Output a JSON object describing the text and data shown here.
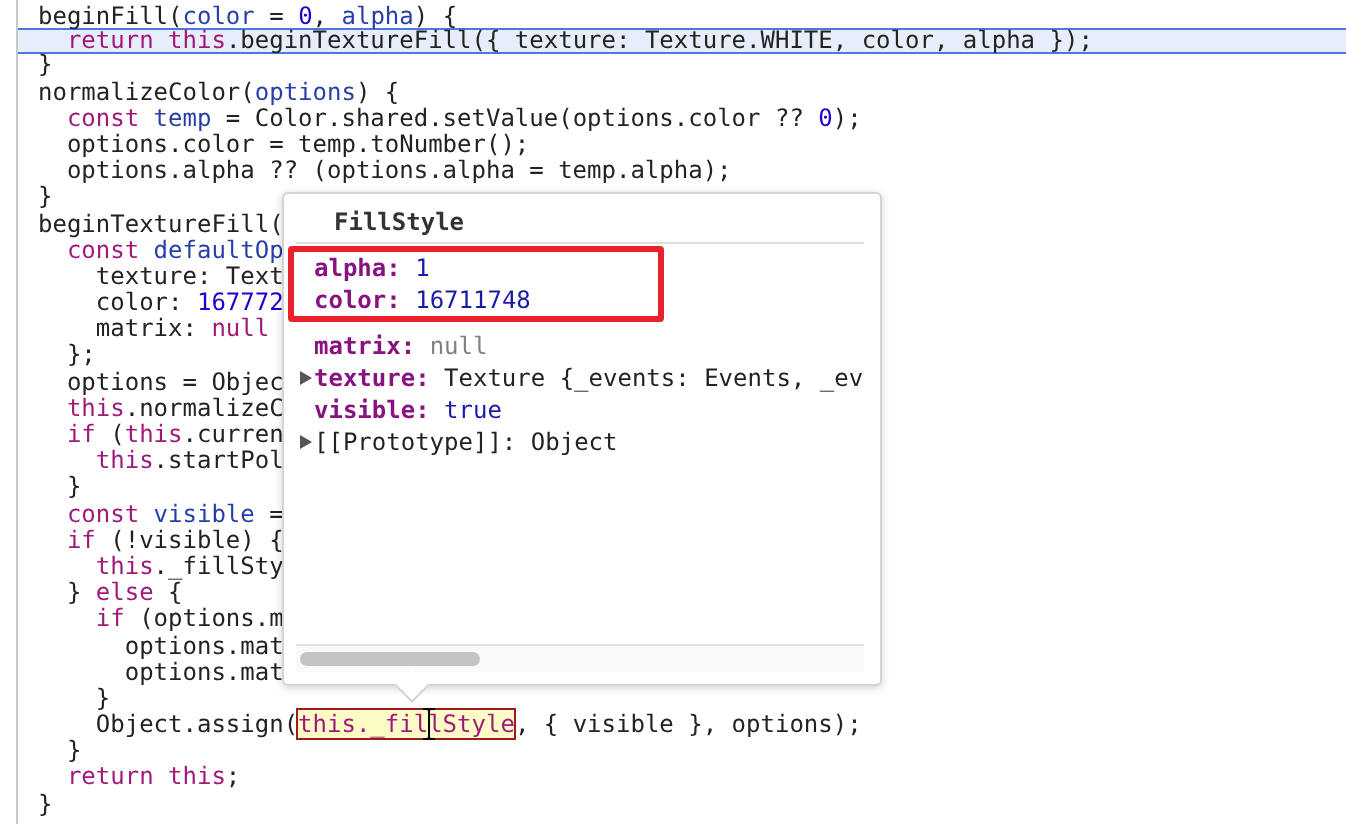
{
  "code_lines": [
    {
      "current": false,
      "tokens": [
        {
          "kind": "plain",
          "text": "beginFill("
        },
        {
          "kind": "param",
          "text": "color"
        },
        {
          "kind": "plain",
          "text": " = "
        },
        {
          "kind": "num",
          "text": "0"
        },
        {
          "kind": "plain",
          "text": ", "
        },
        {
          "kind": "param",
          "text": "alpha"
        },
        {
          "kind": "plain",
          "text": ") {"
        }
      ]
    },
    {
      "current": true,
      "tokens": [
        {
          "kind": "kw",
          "text": "  return "
        },
        {
          "kind": "kw",
          "text": "this"
        },
        {
          "kind": "plain",
          "text": ".beginTextureFill({ texture: Texture.WHITE, color, alpha });"
        }
      ]
    },
    {
      "current": false,
      "tokens": [
        {
          "kind": "plain",
          "text": "}"
        }
      ]
    },
    {
      "current": false,
      "tokens": [
        {
          "kind": "plain",
          "text": "normalizeColor("
        },
        {
          "kind": "param",
          "text": "options"
        },
        {
          "kind": "plain",
          "text": ") {"
        }
      ]
    },
    {
      "current": false,
      "tokens": [
        {
          "kind": "kw",
          "text": "  const "
        },
        {
          "kind": "param",
          "text": "temp"
        },
        {
          "kind": "plain",
          "text": " = Color.shared.setValue(options.color ?? "
        },
        {
          "kind": "num",
          "text": "0"
        },
        {
          "kind": "plain",
          "text": ");"
        }
      ]
    },
    {
      "current": false,
      "tokens": [
        {
          "kind": "plain",
          "text": "  options.color = temp.toNumber();"
        }
      ]
    },
    {
      "current": false,
      "tokens": [
        {
          "kind": "plain",
          "text": "  options.alpha ?? (options.alpha = temp.alpha);"
        }
      ]
    },
    {
      "current": false,
      "tokens": [
        {
          "kind": "plain",
          "text": "}"
        }
      ]
    },
    {
      "current": false,
      "tokens": [
        {
          "kind": "plain",
          "text": "beginTextureFill("
        }
      ]
    },
    {
      "current": false,
      "tokens": [
        {
          "kind": "kw",
          "text": "  const "
        },
        {
          "kind": "param",
          "text": "defaultOp"
        }
      ]
    },
    {
      "current": false,
      "tokens": [
        {
          "kind": "plain",
          "text": "    texture: Text"
        }
      ]
    },
    {
      "current": false,
      "tokens": [
        {
          "kind": "plain",
          "text": "    color: "
        },
        {
          "kind": "num",
          "text": "167772"
        }
      ]
    },
    {
      "current": false,
      "tokens": [
        {
          "kind": "plain",
          "text": "    matrix: "
        },
        {
          "kind": "kw",
          "text": "null"
        }
      ]
    },
    {
      "current": false,
      "tokens": [
        {
          "kind": "plain",
          "text": "  };"
        }
      ]
    },
    {
      "current": false,
      "tokens": [
        {
          "kind": "plain",
          "text": "  options = Objec"
        }
      ]
    },
    {
      "current": false,
      "tokens": [
        {
          "kind": "kw",
          "text": "  this"
        },
        {
          "kind": "plain",
          "text": ".normalizeC"
        }
      ]
    },
    {
      "current": false,
      "tokens": [
        {
          "kind": "kw",
          "text": "  if"
        },
        {
          "kind": "plain",
          "text": " ("
        },
        {
          "kind": "kw",
          "text": "this"
        },
        {
          "kind": "plain",
          "text": ".curren"
        }
      ]
    },
    {
      "current": false,
      "tokens": [
        {
          "kind": "kw",
          "text": "    this"
        },
        {
          "kind": "plain",
          "text": ".startPol"
        }
      ]
    },
    {
      "current": false,
      "tokens": [
        {
          "kind": "plain",
          "text": "  }"
        }
      ]
    },
    {
      "current": false,
      "tokens": [
        {
          "kind": "kw",
          "text": "  const "
        },
        {
          "kind": "param",
          "text": "visible"
        },
        {
          "kind": "plain",
          "text": " ="
        }
      ]
    },
    {
      "current": false,
      "tokens": [
        {
          "kind": "kw",
          "text": "  if"
        },
        {
          "kind": "plain",
          "text": " (!visible) {"
        }
      ]
    },
    {
      "current": false,
      "tokens": [
        {
          "kind": "kw",
          "text": "    this"
        },
        {
          "kind": "plain",
          "text": "._fillSty"
        }
      ]
    },
    {
      "current": false,
      "tokens": [
        {
          "kind": "plain",
          "text": "  } "
        },
        {
          "kind": "kw",
          "text": "else"
        },
        {
          "kind": "plain",
          "text": " {"
        }
      ]
    },
    {
      "current": false,
      "tokens": [
        {
          "kind": "kw",
          "text": "    if"
        },
        {
          "kind": "plain",
          "text": " (options.m"
        }
      ]
    },
    {
      "current": false,
      "tokens": [
        {
          "kind": "plain",
          "text": "      options.mat"
        }
      ]
    },
    {
      "current": false,
      "tokens": [
        {
          "kind": "plain",
          "text": "      options.mat"
        }
      ]
    },
    {
      "current": false,
      "tokens": [
        {
          "kind": "plain",
          "text": "    }"
        }
      ]
    },
    {
      "current": false,
      "tokens": [
        {
          "kind": "plain",
          "text": "    Object.assign("
        },
        {
          "kind": "match",
          "text": "this._fillStyle"
        },
        {
          "kind": "plain",
          "text": ", { visible }, options);"
        }
      ]
    },
    {
      "current": false,
      "tokens": [
        {
          "kind": "plain",
          "text": "  }"
        }
      ]
    },
    {
      "current": false,
      "tokens": [
        {
          "kind": "kw",
          "text": "  return this"
        },
        {
          "kind": "plain",
          "text": ";"
        }
      ]
    },
    {
      "current": false,
      "tokens": [
        {
          "kind": "plain",
          "text": "}"
        }
      ]
    }
  ],
  "popover": {
    "title": "FillStyle",
    "properties": [
      {
        "kind": "own",
        "key": "alpha:",
        "value": {
          "kind": "literal",
          "text": "1"
        },
        "expandable": false,
        "outlined": true
      },
      {
        "kind": "own",
        "key": "color:",
        "value": {
          "kind": "literal",
          "text": "16711748"
        },
        "expandable": false,
        "outlined": true
      },
      {
        "kind": "own",
        "key": "matrix:",
        "value": {
          "kind": "empty",
          "text": "null"
        },
        "expandable": false,
        "outlined": false
      },
      {
        "kind": "own",
        "key": "texture:",
        "value": {
          "kind": "object",
          "text": "Texture {_events: Events, _ev"
        },
        "expandable": true,
        "outlined": false
      },
      {
        "kind": "own",
        "key": "visible:",
        "value": {
          "kind": "literal",
          "text": "true"
        },
        "expandable": false,
        "outlined": false
      },
      {
        "kind": "internal",
        "key": "[[Prototype]]:",
        "value": {
          "kind": "object",
          "text": "Object"
        },
        "expandable": true,
        "outlined": false
      }
    ]
  }
}
